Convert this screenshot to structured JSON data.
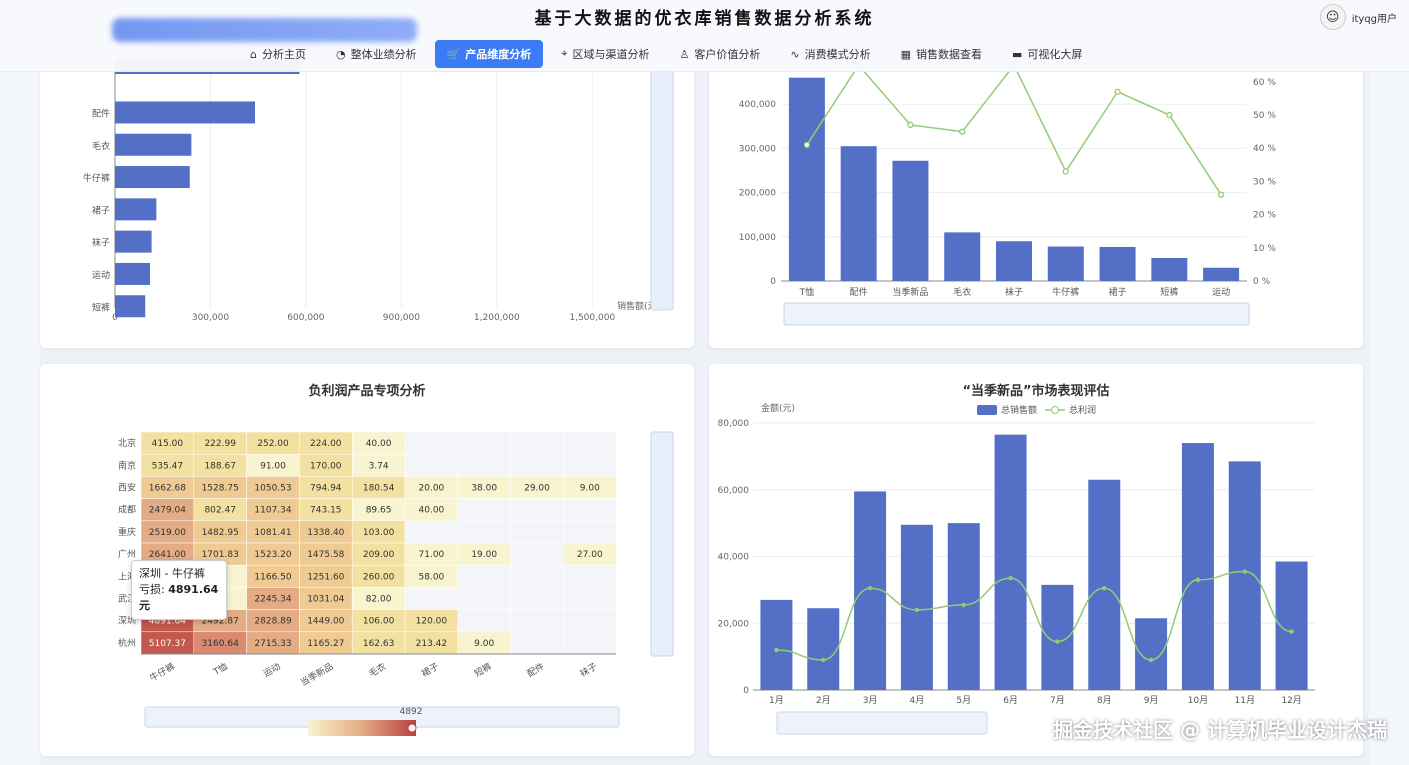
{
  "header": {
    "title": "基于大数据的优衣库销售数据分析系统",
    "user_name": "ityqg用户",
    "nav": [
      {
        "icon": "⌂",
        "label": "分析主页",
        "active": false
      },
      {
        "icon": "◔",
        "label": "整体业绩分析",
        "active": false
      },
      {
        "icon": "🛒",
        "label": "产品维度分析",
        "active": true
      },
      {
        "icon": "⌖",
        "label": "区域与渠道分析",
        "active": false
      },
      {
        "icon": "♙",
        "label": "客户价值分析",
        "active": false
      },
      {
        "icon": "∿",
        "label": "消费模式分析",
        "active": false
      },
      {
        "icon": "▦",
        "label": "销售数据查看",
        "active": false
      },
      {
        "icon": "▬",
        "label": "可视化大屏",
        "active": false
      }
    ]
  },
  "colors": {
    "bar": "#5470c6",
    "line": "#91cc75",
    "accent": "#3b7bf6"
  },
  "chart_data": [
    {
      "type": "bar",
      "orientation": "horizontal",
      "categories": [
        "配件",
        "毛衣",
        "牛仔裤",
        "裙子",
        "袜子",
        "运动",
        "短裤"
      ],
      "values": [
        440000,
        240000,
        235000,
        130000,
        115000,
        110000,
        95000
      ],
      "x_ticks": [
        "0",
        "300,000",
        "600,000",
        "900,000",
        "1,200,000",
        "1,500,000"
      ],
      "xlim": [
        0,
        1650000
      ],
      "xlabel": "销售额(元)"
    },
    {
      "type": "bar",
      "categories": [
        "T恤",
        "配件",
        "当季新品",
        "毛衣",
        "袜子",
        "牛仔裤",
        "裙子",
        "短裤",
        "运动"
      ],
      "series": [
        {
          "kind": "bar",
          "values": [
            460000,
            305000,
            272000,
            110000,
            90000,
            78000,
            77000,
            52000,
            30000
          ]
        },
        {
          "kind": "line",
          "axis": "right",
          "values": [
            41,
            65,
            47,
            45,
            65,
            33,
            57,
            50,
            26
          ]
        }
      ],
      "y_ticks": [
        "0",
        "100,000",
        "200,000",
        "300,000",
        "400,000"
      ],
      "y2_ticks": [
        "0 %",
        "10 %",
        "20 %",
        "30 %",
        "40 %",
        "50 %",
        "60 %"
      ],
      "ylim": [
        0,
        460000
      ],
      "y2lim": [
        0,
        65
      ]
    },
    {
      "type": "heatmap",
      "title": "负利润产品专项分析",
      "rows": [
        "北京",
        "南京",
        "西安",
        "成都",
        "重庆",
        "广州",
        "上海",
        "武汉",
        "深圳",
        "杭州"
      ],
      "columns": [
        "牛仔裤",
        "T恤",
        "运动",
        "当季新品",
        "毛衣",
        "裙子",
        "短裤",
        "配件",
        "袜子"
      ],
      "cells": [
        [
          "415.00",
          "222.99",
          "252.00",
          "224.00",
          "40.00",
          "",
          "",
          "",
          ""
        ],
        [
          "535.47",
          "188.67",
          "91.00",
          "170.00",
          "3.74",
          "",
          "",
          "",
          ""
        ],
        [
          "1662.68",
          "1528.75",
          "1050.53",
          "794.94",
          "180.54",
          "20.00",
          "38.00",
          "29.00",
          "9.00"
        ],
        [
          "2479.04",
          "802.47",
          "1107.34",
          "743.15",
          "89.65",
          "40.00",
          "",
          "",
          ""
        ],
        [
          "2519.00",
          "1482.95",
          "1081.41",
          "1338.40",
          "103.00",
          "",
          "",
          "",
          ""
        ],
        [
          "2641.00",
          "1701.83",
          "1523.20",
          "1475.58",
          "209.00",
          "71.00",
          "19.00",
          "",
          "27.00"
        ],
        [
          "",
          "18",
          "1166.50",
          "1251.60",
          "260.00",
          "58.00",
          "",
          "",
          ""
        ],
        [
          "",
          "87",
          "2245.34",
          "1031.04",
          "82.00",
          "",
          "",
          "",
          ""
        ],
        [
          "4891.64",
          "2492.87",
          "2828.89",
          "1449.00",
          "106.00",
          "120.00",
          "",
          "",
          ""
        ],
        [
          "5107.37",
          "3160.64",
          "2715.33",
          "1165.27",
          "162.63",
          "213.42",
          "9.00",
          "",
          ""
        ]
      ],
      "visual_map_value": "4892",
      "tooltip": {
        "title": "深圳 - 牛仔裤",
        "label": "亏损:",
        "value": "4891.64 元"
      }
    },
    {
      "type": "bar",
      "title": "“当季新品”市场表现评估",
      "ylabel": "金额(元)",
      "legend": [
        "总销售额",
        "总利润"
      ],
      "categories": [
        "1月",
        "2月",
        "3月",
        "4月",
        "5月",
        "6月",
        "7月",
        "8月",
        "9月",
        "10月",
        "11月",
        "12月"
      ],
      "series": [
        {
          "name": "总销售额",
          "kind": "bar",
          "values": [
            27000,
            24500,
            59500,
            49500,
            50000,
            76500,
            31500,
            63000,
            21500,
            74000,
            68500,
            38500
          ]
        },
        {
          "name": "总利润",
          "kind": "line",
          "values": [
            12000,
            9000,
            30500,
            24000,
            25500,
            33500,
            14500,
            30500,
            9000,
            33000,
            35500,
            17500
          ]
        }
      ],
      "y_ticks": [
        "0",
        "20,000",
        "40,000",
        "60,000",
        "80,000"
      ],
      "ylim": [
        0,
        80000
      ]
    }
  ],
  "watermark": "掘金技术社区 @ 计算机毕业设计杰瑞"
}
